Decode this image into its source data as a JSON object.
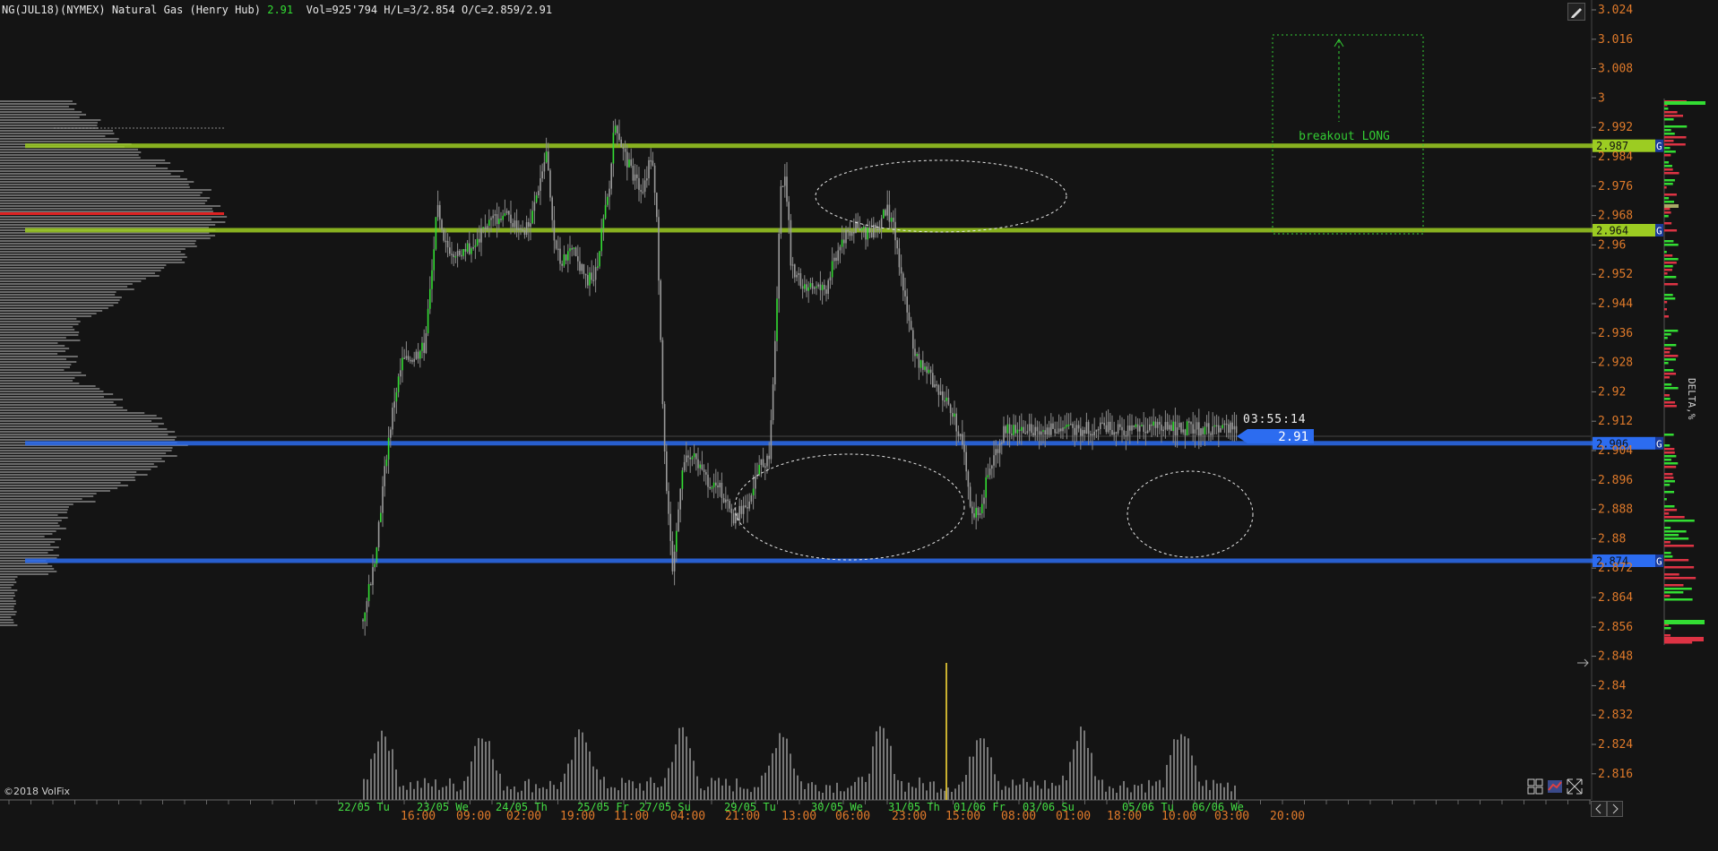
{
  "header": {
    "symbol": "NG(JUL18)(NYMEX) Natural Gas (Henry Hub)",
    "last": "2.91",
    "stats": "Vol=925'794 H/L=3/2.854 O/C=2.859/2.91"
  },
  "copyright": "©2018 VolFix",
  "indicator_label": "DELTA,%",
  "timer": "03:55:14",
  "price_tag": "2.91",
  "colors": {
    "background": "#141414",
    "resistance": "#9ccc22",
    "support": "#2c6cf0",
    "bull": "#33dd33",
    "bear": "#dd3344",
    "axis_text": "#e07a2a",
    "date_text": "#44dd44",
    "annotation": "#33cc33",
    "poc": "#dd2222"
  },
  "icons": {
    "pencil": "pencil-icon",
    "grid": "grid-icon",
    "layers": "layers-icon",
    "expand": "expand-icon",
    "pan_left": "pan-left-icon",
    "pan_right": "pan-right-icon"
  },
  "annotations": {
    "breakout_text": "breakout LONG"
  },
  "chart_data": {
    "type": "candlestick",
    "title": "NG(JUL18)(NYMEX) Natural Gas (Henry Hub)",
    "yaxis": {
      "ticks": [
        "3.024",
        "3.016",
        "3.008",
        "3",
        "2.992",
        "2.984",
        "2.976",
        "2.968",
        "2.96",
        "2.952",
        "2.944",
        "2.936",
        "2.928",
        "2.92",
        "2.912",
        "2.904",
        "2.896",
        "2.888",
        "2.88",
        "2.872",
        "2.864",
        "2.856",
        "2.848",
        "2.84",
        "2.832",
        "2.824",
        "2.816"
      ],
      "range": [
        2.813,
        3.027
      ]
    },
    "xaxis": {
      "dates": [
        "22/05 Tu",
        "23/05 We",
        "24/05 Th",
        "25/05 Fr",
        "27/05 Su",
        "29/05 Tu",
        "30/05 We",
        "31/05 Th",
        "01/06 Fr",
        "03/06 Su",
        "05/06 Tu",
        "06/06 We"
      ],
      "times": [
        "16:00",
        "09:00",
        "02:00",
        "19:00",
        "11:00",
        "04:00",
        "21:00",
        "13:00",
        "06:00",
        "23:00",
        "15:00",
        "08:00",
        "01:00",
        "18:00",
        "10:00",
        "03:00",
        "20:00"
      ]
    },
    "levels": [
      {
        "price": 2.987,
        "label": "2.987",
        "kind": "resistance",
        "marker": "G"
      },
      {
        "price": 2.964,
        "label": "2.964",
        "kind": "resistance",
        "marker": "G"
      },
      {
        "price": 2.906,
        "label": "2.906",
        "kind": "support",
        "marker": "G"
      },
      {
        "price": 2.874,
        "label": "2.874",
        "kind": "support",
        "marker": "G"
      }
    ],
    "last_price": 2.91,
    "price_path": [
      [
        0,
        2.858
      ],
      [
        0.006,
        2.866
      ],
      [
        0.012,
        2.872
      ],
      [
        0.02,
        2.888
      ],
      [
        0.028,
        2.905
      ],
      [
        0.036,
        2.918
      ],
      [
        0.045,
        2.928
      ],
      [
        0.06,
        2.93
      ],
      [
        0.07,
        2.932
      ],
      [
        0.078,
        2.95
      ],
      [
        0.085,
        2.97
      ],
      [
        0.092,
        2.96
      ],
      [
        0.11,
        2.958
      ],
      [
        0.13,
        2.96
      ],
      [
        0.142,
        2.966
      ],
      [
        0.16,
        2.968
      ],
      [
        0.175,
        2.966
      ],
      [
        0.19,
        2.964
      ],
      [
        0.2,
        2.975
      ],
      [
        0.21,
        2.985
      ],
      [
        0.218,
        2.962
      ],
      [
        0.226,
        2.955
      ],
      [
        0.24,
        2.958
      ],
      [
        0.255,
        2.951
      ],
      [
        0.265,
        2.95
      ],
      [
        0.272,
        2.962
      ],
      [
        0.282,
        2.975
      ],
      [
        0.288,
        2.995
      ],
      [
        0.297,
        2.986
      ],
      [
        0.31,
        2.978
      ],
      [
        0.322,
        2.975
      ],
      [
        0.33,
        2.985
      ],
      [
        0.336,
        2.97
      ],
      [
        0.343,
        2.918
      ],
      [
        0.348,
        2.89
      ],
      [
        0.355,
        2.87
      ],
      [
        0.365,
        2.9
      ],
      [
        0.375,
        2.903
      ],
      [
        0.39,
        2.897
      ],
      [
        0.41,
        2.893
      ],
      [
        0.425,
        2.885
      ],
      [
        0.44,
        2.89
      ],
      [
        0.455,
        2.9
      ],
      [
        0.465,
        2.903
      ],
      [
        0.472,
        2.935
      ],
      [
        0.478,
        2.975
      ],
      [
        0.484,
        2.978
      ],
      [
        0.49,
        2.955
      ],
      [
        0.5,
        2.95
      ],
      [
        0.515,
        2.948
      ],
      [
        0.53,
        2.948
      ],
      [
        0.545,
        2.96
      ],
      [
        0.56,
        2.965
      ],
      [
        0.575,
        2.963
      ],
      [
        0.59,
        2.965
      ],
      [
        0.6,
        2.97
      ],
      [
        0.61,
        2.962
      ],
      [
        0.62,
        2.945
      ],
      [
        0.632,
        2.93
      ],
      [
        0.645,
        2.925
      ],
      [
        0.66,
        2.92
      ],
      [
        0.675,
        2.915
      ],
      [
        0.688,
        2.903
      ],
      [
        0.696,
        2.885
      ],
      [
        0.706,
        2.888
      ],
      [
        0.716,
        2.898
      ],
      [
        0.726,
        2.905
      ],
      [
        0.735,
        2.91
      ]
    ],
    "volume_profile_note": "horizontal volume profile at left",
    "delta_note": "delta % histogram at right"
  }
}
